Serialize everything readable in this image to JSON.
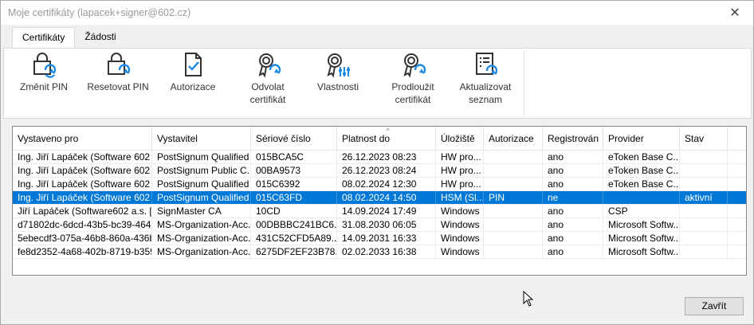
{
  "window": {
    "title": "Moje certifikáty (lapacek+signer@602.cz)",
    "close_glyph": "✕"
  },
  "tabs": [
    {
      "label": "Certifikáty",
      "active": true
    },
    {
      "label": "Žádosti",
      "active": false
    }
  ],
  "ribbon": {
    "buttons": [
      {
        "label": "Změnit PIN",
        "icon": "lock-refresh-icon"
      },
      {
        "label": "Resetovat PIN",
        "icon": "lock-refresh-icon"
      },
      {
        "label": "Autorizace",
        "icon": "document-check-icon"
      },
      {
        "label": "Odvolat certifikát",
        "icon": "certificate-revoke-icon"
      },
      {
        "label": "Vlastnosti",
        "icon": "certificate-properties-icon"
      },
      {
        "label": "Prodloužit certifikát",
        "icon": "certificate-renew-icon"
      },
      {
        "label": "Aktualizovat seznam",
        "icon": "list-refresh-icon"
      }
    ]
  },
  "grid": {
    "columns": [
      "Vystaveno pro",
      "Vystavitel",
      "Sériové číslo",
      "Platnost do",
      "Úložiště",
      "Autorizace",
      "Registrován",
      "Provider",
      "Stav"
    ],
    "sorted_column": "Platnost do",
    "rows": [
      [
        "Ing. Jiří Lapáček (Software 602 ...",
        "PostSignum Qualified ...",
        "015BCA5C",
        "26.12.2023 08:23",
        "HW pro...",
        "",
        "ano",
        "eToken Base C...",
        ""
      ],
      [
        "Ing. Jiří Lapáček (Software 602 ...",
        "PostSignum Public C...",
        "00BA9573",
        "26.12.2023 08:24",
        "HW pro...",
        "",
        "ano",
        "eToken Base C...",
        ""
      ],
      [
        "Ing. Jiří Lapáček (Software 602 ...",
        "PostSignum Qualified ...",
        "015C6392",
        "08.02.2024 12:30",
        "HW pro...",
        "",
        "ano",
        "eToken Base C...",
        ""
      ],
      [
        "Ing. Jiří Lapáček (Software 602 ...",
        "PostSignum Qualified ...",
        "015C63FD",
        "08.02.2024 14:50",
        "HSM (Sl...",
        "PIN",
        "ne",
        "",
        "aktivní"
      ],
      [
        "Jiří Lapáček (Software602 a.s. [I...",
        "SignMaster CA",
        "10CD",
        "14.09.2024 17:49",
        "Windows",
        "",
        "ano",
        "CSP",
        ""
      ],
      [
        "d71802dc-6dcd-43b5-bc39-4643...",
        "MS-Organization-Acc...",
        "00DBBBC241BC6...",
        "31.08.2030 06:05",
        "Windows",
        "",
        "ano",
        "Microsoft Softw...",
        ""
      ],
      [
        "5ebecdf3-075a-46b8-860a-436b...",
        "MS-Organization-Acc...",
        "431C52CFD5A89...",
        "14.09.2031 16:33",
        "Windows",
        "",
        "ano",
        "Microsoft Softw...",
        ""
      ],
      [
        "fe8d2352-4a68-402b-8719-b3596...",
        "MS-Organization-Acc...",
        "6275DF2EF23B78...",
        "02.02.2033 16:38",
        "Windows",
        "",
        "ano",
        "Microsoft Softw...",
        ""
      ]
    ],
    "selected_row": 3
  },
  "footer": {
    "close_label": "Zavřít"
  },
  "colors": {
    "accent": "#0078d7",
    "icon_dark": "#333333",
    "icon_blue": "#1e88e5"
  }
}
